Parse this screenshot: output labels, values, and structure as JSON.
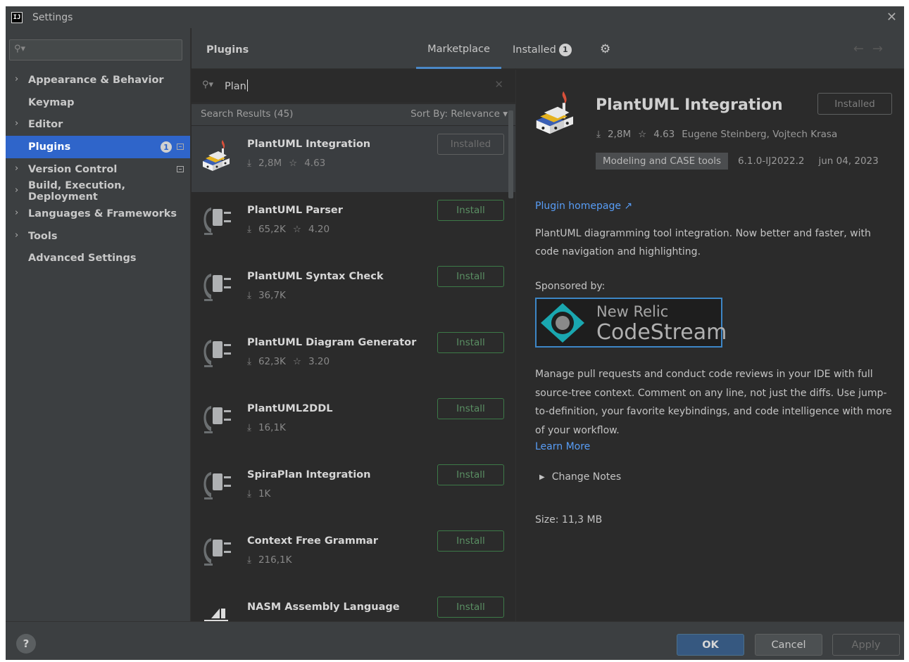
{
  "window": {
    "title": "Settings",
    "logo": "IJ"
  },
  "sidebar": {
    "items": [
      {
        "label": "Appearance & Behavior",
        "chevron": true
      },
      {
        "label": "Keymap",
        "chevron": false
      },
      {
        "label": "Editor",
        "chevron": true
      },
      {
        "label": "Plugins",
        "chevron": false,
        "selected": true,
        "badge": "1"
      },
      {
        "label": "Version Control",
        "chevron": true
      },
      {
        "label": "Build, Execution, Deployment",
        "chevron": true
      },
      {
        "label": "Languages & Frameworks",
        "chevron": true
      },
      {
        "label": "Tools",
        "chevron": true
      },
      {
        "label": "Advanced Settings",
        "chevron": false
      }
    ]
  },
  "header": {
    "title": "Plugins",
    "tab_marketplace": "Marketplace",
    "tab_installed": "Installed",
    "installed_count": "1"
  },
  "search": {
    "query": "Plan"
  },
  "results": {
    "count_label": "Search Results (45)",
    "sort_label": "Sort By: Relevance"
  },
  "plugins": [
    {
      "name": "PlantUML Integration",
      "downloads": "2,8M",
      "rating": "4.63",
      "button": "Installed"
    },
    {
      "name": "PlantUML Parser",
      "downloads": "65,2K",
      "rating": "4.20",
      "button": "Install"
    },
    {
      "name": "PlantUML Syntax Check",
      "downloads": "36,7K",
      "rating": "",
      "button": "Install"
    },
    {
      "name": "PlantUML Diagram Generator",
      "downloads": "62,3K",
      "rating": "3.20",
      "button": "Install"
    },
    {
      "name": "PlantUML2DDL",
      "downloads": "16,1K",
      "rating": "",
      "button": "Install"
    },
    {
      "name": "SpiraPlan Integration",
      "downloads": "1K",
      "rating": "",
      "button": "Install"
    },
    {
      "name": "Context Free Grammar",
      "downloads": "216,1K",
      "rating": "",
      "button": "Install"
    },
    {
      "name": "NASM Assembly Language",
      "downloads": "",
      "rating": "",
      "button": "Install"
    }
  ],
  "detail": {
    "title": "PlantUML Integration",
    "button": "Installed",
    "downloads": "2,8M",
    "rating": "4.63",
    "authors": "Eugene Steinberg, Vojtech Krasa",
    "tag": "Modeling and CASE tools",
    "version": "6.1.0-IJ2022.2",
    "date": "jun 04, 2023",
    "homepage": "Plugin homepage ↗",
    "description": "PlantUML diagramming tool integration. Now better and faster, with code navigation and highlighting.",
    "sponsored_by": "Sponsored by:",
    "banner_line1": "New Relic",
    "banner_line2": "CodeStream",
    "sponsor_description": "Manage pull requests and conduct code reviews in your IDE with full source-tree context. Comment on any line, not just the diffs. Use jump-to-definition, your favorite keybindings, and code intelligence with more of your workflow.",
    "learn_more": "Learn More",
    "change_notes": "Change Notes",
    "size": "Size: 11,3 MB"
  },
  "footer": {
    "help": "?",
    "ok": "OK",
    "cancel": "Cancel",
    "apply": "Apply"
  },
  "colors": {
    "accent": "#2f65ca",
    "link": "#589df6",
    "install_green": "#3d7a48"
  }
}
